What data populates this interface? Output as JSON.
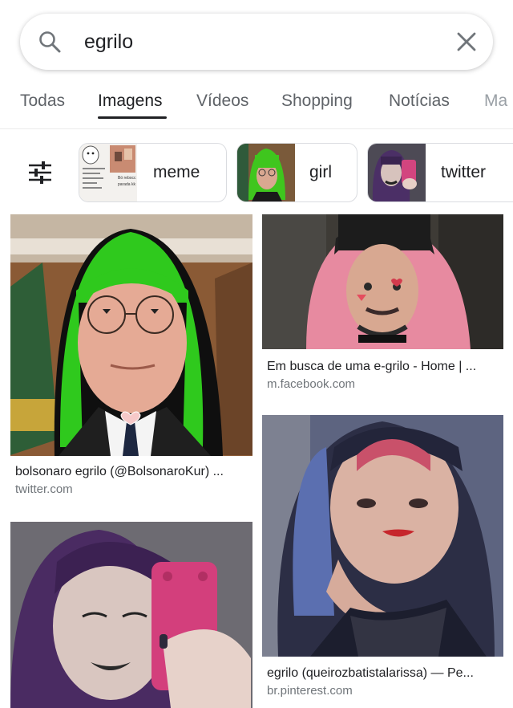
{
  "search": {
    "query": "egrilo"
  },
  "tabs": [
    {
      "label": "Todas"
    },
    {
      "label": "Imagens"
    },
    {
      "label": "Vídeos"
    },
    {
      "label": "Shopping"
    },
    {
      "label": "Notícias"
    },
    {
      "label": "Ma"
    }
  ],
  "chips": [
    {
      "label": "meme"
    },
    {
      "label": "girl"
    },
    {
      "label": "twitter"
    }
  ],
  "meme_thumb_text": [
    "Bó rebocc",
    "parada kk"
  ],
  "results": [
    {
      "title": "bolsonaro egrilo (@BolsonaroKur) ...",
      "source": "twitter.com"
    },
    {
      "title": "Em busca de uma e-grilo - Home | ...",
      "source": "m.facebook.com"
    },
    {
      "title": "egrilo (queirozbatistalarissa) — Pe...",
      "source": "br.pinterest.com"
    },
    {
      "title": "",
      "source": ""
    }
  ],
  "colors": {
    "accent": "#1a73e8",
    "text": "#202124",
    "muted": "#70757a"
  }
}
